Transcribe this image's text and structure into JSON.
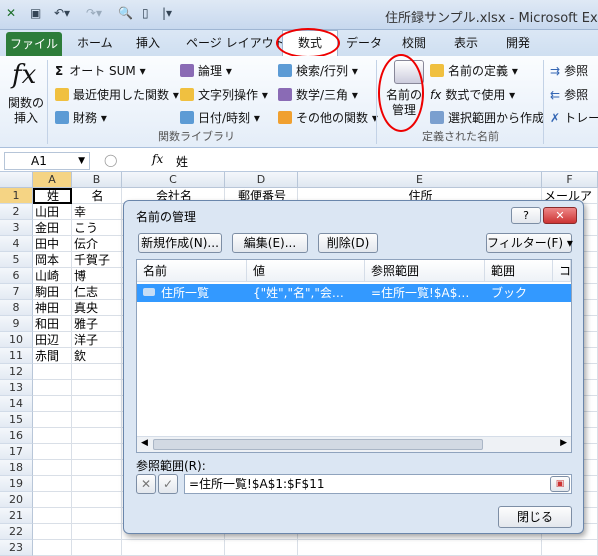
{
  "window": {
    "title": "住所録サンプル.xlsx - Microsoft Excel"
  },
  "tabs": {
    "file": "ファイル",
    "home": "ホーム",
    "insert": "挿入",
    "page_layout": "ページ レイアウト",
    "formulas": "数式",
    "data": "データ",
    "review": "校閲",
    "view": "表示",
    "developer": "開発"
  },
  "ribbon": {
    "insert_function": "関数の\n挿入",
    "autosum": "オート SUM",
    "recent": "最近使用した関数",
    "financial": "財務",
    "logical": "論理",
    "text": "文字列操作",
    "datetime": "日付/時刻",
    "lookup": "検索/行列",
    "math": "数学/三角",
    "more": "その他の関数",
    "group_library": "関数ライブラリ",
    "name_manager": "名前の\n管理",
    "define_name": "名前の定義",
    "use_in_formula": "数式で使用",
    "create_from_selection": "選択範囲から作成",
    "group_names": "定義された名前",
    "trace_precedents": "参照",
    "trace_dependents": "参照",
    "remove_arrows": "トレー"
  },
  "formula_bar": {
    "name_box": "A1",
    "fx": "fx",
    "content": "姓"
  },
  "sheet": {
    "columns": [
      "A",
      "B",
      "C",
      "D",
      "E",
      "F"
    ],
    "header_partial": {
      "C": "会社名",
      "D": "郵便番号",
      "E": "住所",
      "F": "メールア"
    },
    "rows": [
      "1",
      "2",
      "3",
      "4",
      "5",
      "6",
      "7",
      "8",
      "9",
      "10",
      "11",
      "12",
      "13",
      "14",
      "15",
      "16",
      "17",
      "18",
      "19",
      "20",
      "21",
      "22",
      "23"
    ],
    "data": [
      [
        "姓",
        "名"
      ],
      [
        "山田",
        "幸"
      ],
      [
        "金田",
        "こう"
      ],
      [
        "田中",
        "伝介"
      ],
      [
        "岡本",
        "千賀子"
      ],
      [
        "山崎",
        "博"
      ],
      [
        "駒田",
        "仁志"
      ],
      [
        "神田",
        "真央"
      ],
      [
        "和田",
        "雅子"
      ],
      [
        "田辺",
        "洋子"
      ],
      [
        "赤間",
        "欽"
      ]
    ]
  },
  "dialog": {
    "title": "名前の管理",
    "help": "?",
    "close": "✕",
    "new": "新規作成(N)...",
    "edit": "編集(E)...",
    "delete": "削除(D)",
    "filter": "フィルター(F) ▾",
    "col_name": "名前",
    "col_value": "値",
    "col_ref": "参照範囲",
    "col_scope": "範囲",
    "col_comment": "コ",
    "entry": {
      "name": "住所一覧",
      "value": "{\"姓\",\"名\",\"会…",
      "ref": "=住所一覧!$A$…",
      "scope": "ブック"
    },
    "ref_label": "参照範囲(R):",
    "ref_value": "=住所一覧!$A$1:$F$11",
    "close_button": "閉じる"
  }
}
